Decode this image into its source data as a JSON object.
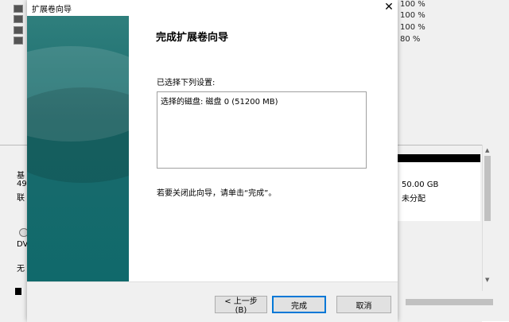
{
  "background": {
    "percent_values": [
      "100 %",
      "100 %",
      "100 %",
      "80 %"
    ],
    "disk_labels": [
      "基",
      "49",
      "联"
    ],
    "dvd_label": "DV",
    "dvd_status": "无",
    "unallocated_size": "50.00 GB",
    "unallocated_text": "未分配"
  },
  "dialog": {
    "title": "扩展卷向导",
    "close_glyph": "✕",
    "heading": "完成扩展卷向导",
    "selected_settings_label": "已选择下列设置:",
    "summary_lines": [
      "选择的磁盘: 磁盘 0 (51200 MB)"
    ],
    "finish_hint": "若要关闭此向导，请单击“完成”。",
    "buttons": {
      "back": "< 上一步(B)",
      "finish": "完成",
      "cancel": "取消"
    }
  },
  "colors": {
    "banner_teal": "#10696b",
    "default_button_border": "#0078d7"
  }
}
